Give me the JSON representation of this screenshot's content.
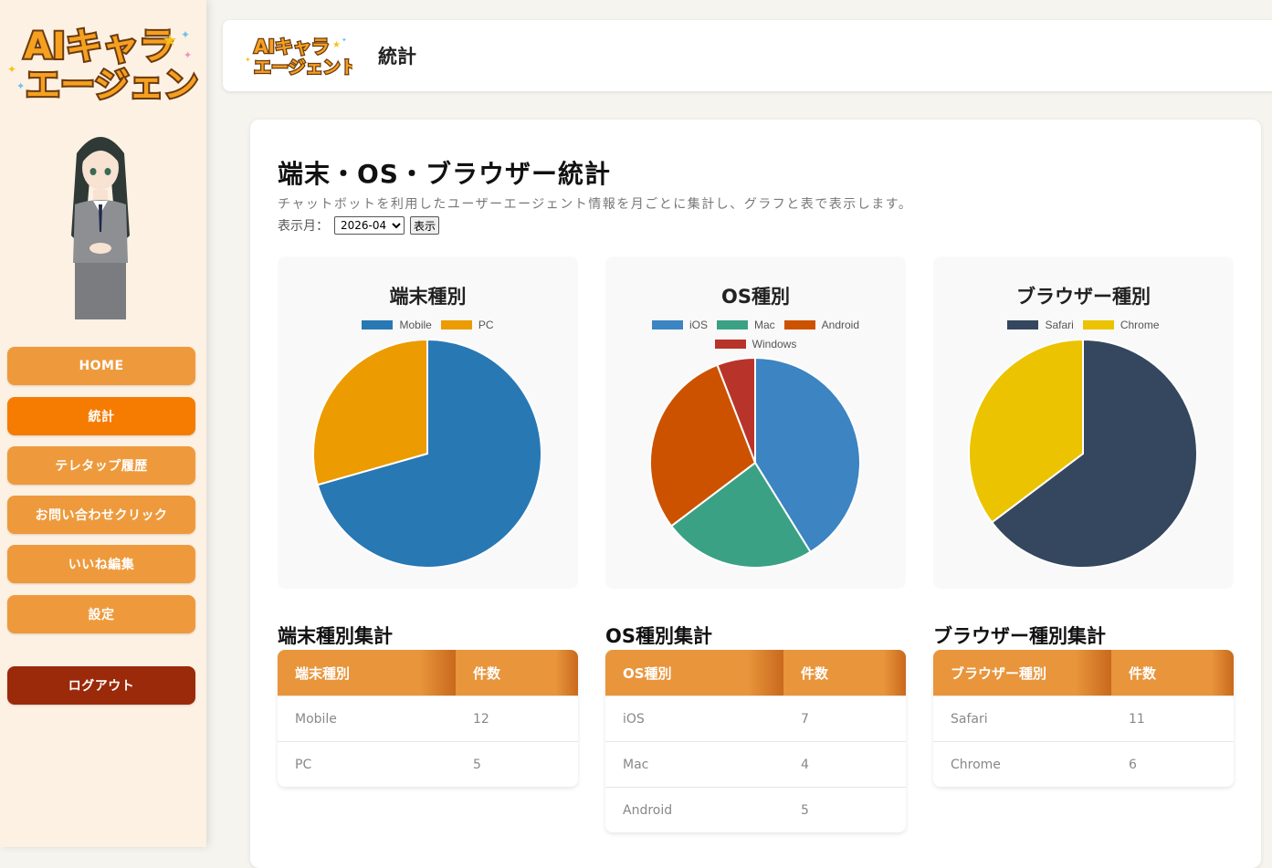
{
  "app": {
    "logo_text": "AIキャラエージェント"
  },
  "sidebar": {
    "items": [
      {
        "label": "HOME"
      },
      {
        "label": "統計"
      },
      {
        "label": "テレタップ履歴"
      },
      {
        "label": "お問い合わせクリック"
      },
      {
        "label": "いいね編集"
      },
      {
        "label": "設定"
      }
    ],
    "logout_label": "ログアウト",
    "active_item": "統計"
  },
  "header": {
    "title": "統計"
  },
  "main": {
    "title": "端末・OS・ブラウザー統計",
    "description": "チャットボットを利用したユーザーエージェント情報を月ごとに集計し、グラフと表で表示します。",
    "month_label": "表示月：",
    "month_value": "2026-04",
    "show_button": "表示"
  },
  "chart_data": [
    {
      "type": "pie",
      "title": "端末種別",
      "categories": [
        "Mobile",
        "PC"
      ],
      "values": [
        12,
        5
      ],
      "colors": [
        "#2878b4",
        "#ec9b00"
      ]
    },
    {
      "type": "pie",
      "title": "OS種別",
      "categories": [
        "iOS",
        "Mac",
        "Android",
        "Windows"
      ],
      "values": [
        7,
        4,
        5,
        1
      ],
      "colors": [
        "#3c84c2",
        "#3ba184",
        "#cc5200",
        "#b8342a"
      ]
    },
    {
      "type": "pie",
      "title": "ブラウザー種別",
      "categories": [
        "Safari",
        "Chrome"
      ],
      "values": [
        11,
        6
      ],
      "colors": [
        "#34475e",
        "#ebc300"
      ]
    }
  ],
  "tables": [
    {
      "title": "端末種別集計",
      "headers": [
        "端末種別",
        "件数"
      ],
      "rows": [
        [
          "Mobile",
          "12"
        ],
        [
          "PC",
          "5"
        ]
      ]
    },
    {
      "title": "OS種別集計",
      "headers": [
        "OS種別",
        "件数"
      ],
      "rows": [
        [
          "iOS",
          "7"
        ],
        [
          "Mac",
          "4"
        ],
        [
          "Android",
          "5"
        ]
      ]
    },
    {
      "title": "ブラウザー種別集計",
      "headers": [
        "ブラウザー種別",
        "件数"
      ],
      "rows": [
        [
          "Safari",
          "11"
        ],
        [
          "Chrome",
          "6"
        ]
      ]
    }
  ]
}
